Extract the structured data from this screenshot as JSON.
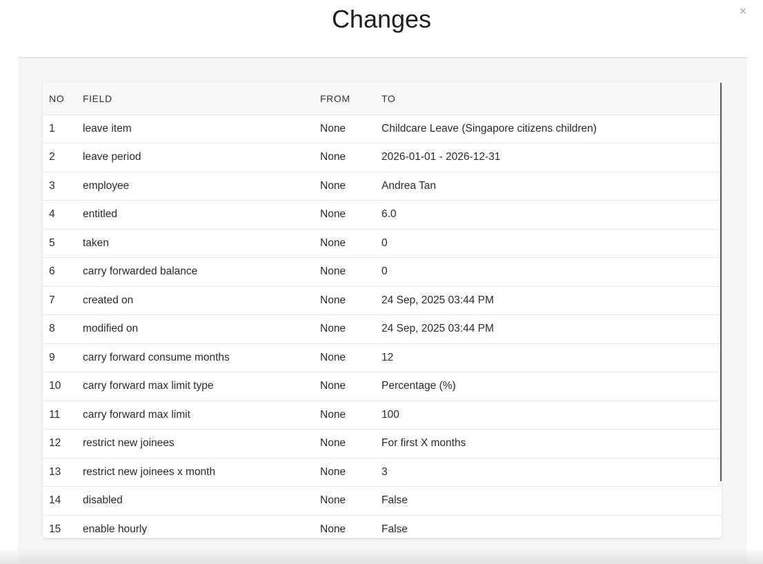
{
  "modal": {
    "title": "Changes",
    "close_glyph": "×"
  },
  "table": {
    "headers": {
      "no": "NO",
      "field": "FIELD",
      "from": "FROM",
      "to": "TO"
    },
    "rows": [
      {
        "no": "1",
        "field": "leave item",
        "from": "None",
        "to": "Childcare Leave (Singapore citizens children)"
      },
      {
        "no": "2",
        "field": "leave period",
        "from": "None",
        "to": "2026-01-01 - 2026-12-31"
      },
      {
        "no": "3",
        "field": "employee",
        "from": "None",
        "to": "Andrea Tan"
      },
      {
        "no": "4",
        "field": "entitled",
        "from": "None",
        "to": "6.0"
      },
      {
        "no": "5",
        "field": "taken",
        "from": "None",
        "to": "0"
      },
      {
        "no": "6",
        "field": "carry forwarded balance",
        "from": "None",
        "to": "0"
      },
      {
        "no": "7",
        "field": "created on",
        "from": "None",
        "to": "24 Sep, 2025 03:44 PM"
      },
      {
        "no": "8",
        "field": "modified on",
        "from": "None",
        "to": "24 Sep, 2025 03:44 PM"
      },
      {
        "no": "9",
        "field": "carry forward consume months",
        "from": "None",
        "to": "12"
      },
      {
        "no": "10",
        "field": "carry forward max limit type",
        "from": "None",
        "to": "Percentage (%)"
      },
      {
        "no": "11",
        "field": "carry forward max limit",
        "from": "None",
        "to": "100"
      },
      {
        "no": "12",
        "field": "restrict new joinees",
        "from": "None",
        "to": "For first X months"
      },
      {
        "no": "13",
        "field": "restrict new joinees x month",
        "from": "None",
        "to": "3"
      },
      {
        "no": "14",
        "field": "disabled",
        "from": "None",
        "to": "False"
      },
      {
        "no": "15",
        "field": "enable hourly",
        "from": "None",
        "to": "False"
      }
    ]
  }
}
